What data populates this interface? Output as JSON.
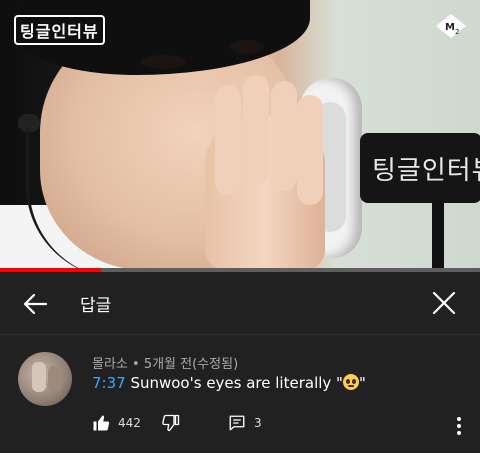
{
  "video": {
    "logo_text": "팅글인터뷰",
    "mic_label": "팅글인터뷰",
    "progress_fraction": 0.21
  },
  "header": {
    "title": "답글"
  },
  "comment": {
    "author": "몰라소",
    "time": "5개월 전(수정됨)",
    "separator": " • ",
    "timestamp_link": "7:37",
    "text_before_emoji": " Sunwoo's eyes are literally \"",
    "text_after_emoji": "\"",
    "like_count": "442",
    "reply_count": "3"
  },
  "icons": {
    "back": "arrow-left-icon",
    "close": "close-icon",
    "like": "thumbs-up-icon",
    "dislike": "thumbs-down-icon",
    "reply": "reply-icon",
    "more": "more-vert-icon",
    "channel": "m2-logo-icon"
  },
  "colors": {
    "background": "#212121",
    "link": "#3ea6ff",
    "progress": "#ff0000"
  }
}
